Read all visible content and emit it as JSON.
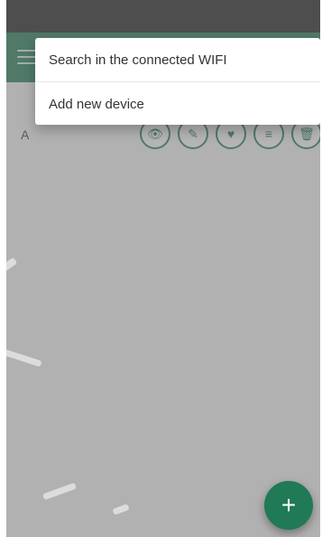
{
  "menu": {
    "items": [
      {
        "label": "Search in the connected WIFI"
      },
      {
        "label": "Add new device"
      }
    ]
  },
  "device_list": {
    "rows": [
      {
        "name": "A"
      }
    ]
  },
  "actions": {
    "icons": [
      {
        "name": "eye-icon",
        "glyph": "👁"
      },
      {
        "name": "pencil-icon",
        "glyph": "✎"
      },
      {
        "name": "heart-icon",
        "glyph": "♥"
      },
      {
        "name": "list-icon",
        "glyph": "≡"
      },
      {
        "name": "trash-icon",
        "glyph": "🗑"
      }
    ]
  },
  "fab": {
    "label": "+"
  },
  "colors": {
    "primary": "#1f7a55",
    "statusbar": "#1c1c1c",
    "overlay": "rgba(120,120,120,0.55)"
  }
}
